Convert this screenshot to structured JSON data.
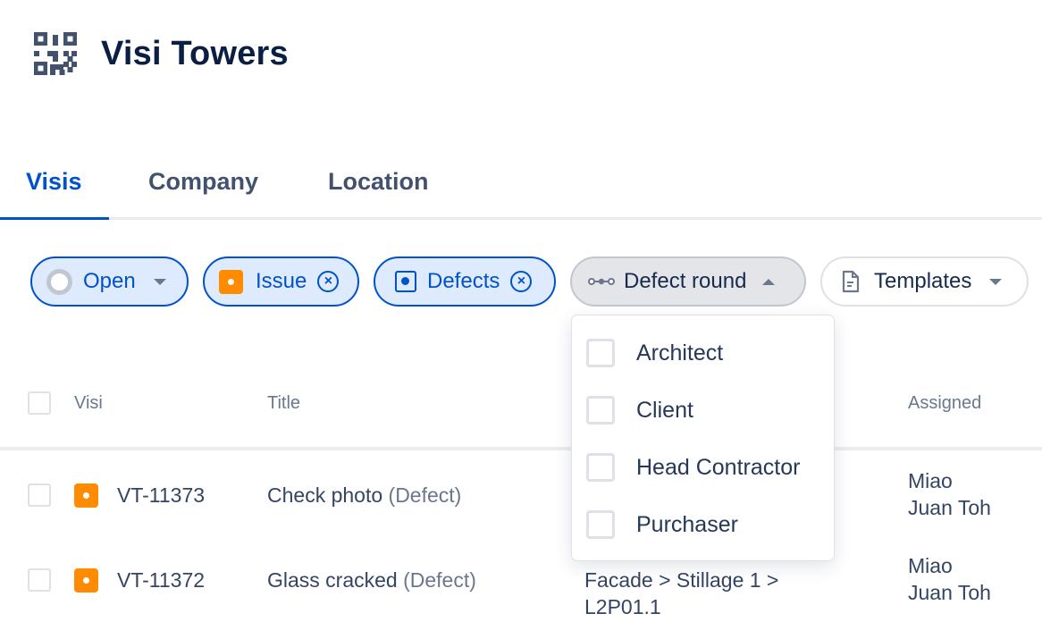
{
  "header": {
    "logo_icon": "qr-code-icon",
    "title": "Visi Towers"
  },
  "tabs": [
    {
      "label": "Visis",
      "active": true
    },
    {
      "label": "Company",
      "active": false
    },
    {
      "label": "Location",
      "active": false
    }
  ],
  "filters": {
    "status": {
      "label": "Open",
      "icon": "status-circle-icon",
      "state": "selected"
    },
    "type": {
      "label": "Issue",
      "icon": "issue-icon",
      "state": "selected"
    },
    "category": {
      "label": "Defects",
      "icon": "defects-icon",
      "state": "selected"
    },
    "defect_round": {
      "label": "Defect round",
      "icon": "workflow-icon",
      "state": "open"
    },
    "templates": {
      "label": "Templates",
      "icon": "document-icon",
      "state": "default"
    }
  },
  "defect_round_menu": {
    "options": [
      {
        "label": "Architect",
        "checked": false
      },
      {
        "label": "Client",
        "checked": false
      },
      {
        "label": "Head Contractor",
        "checked": false
      },
      {
        "label": "Purchaser",
        "checked": false
      }
    ]
  },
  "table": {
    "columns": {
      "visi": "Visi",
      "title": "Title",
      "assigned": "Assigned"
    },
    "rows": [
      {
        "id": "VT-11373",
        "title": "Check photo",
        "kind": "(Defect)",
        "location_line1": "",
        "location_line2": "",
        "assigned_line1": "Miao",
        "assigned_line2": "Juan Toh"
      },
      {
        "id": "VT-11372",
        "title": "Glass cracked",
        "kind": "(Defect)",
        "location_line1": "Facade > Stillage 1 >",
        "location_line2": "L2P01.1",
        "assigned_line1": "Miao",
        "assigned_line2": "Juan Toh"
      }
    ]
  },
  "colors": {
    "accent": "#0052cc",
    "issue_badge": "#ff8b00",
    "title_text": "#0b1f44"
  }
}
